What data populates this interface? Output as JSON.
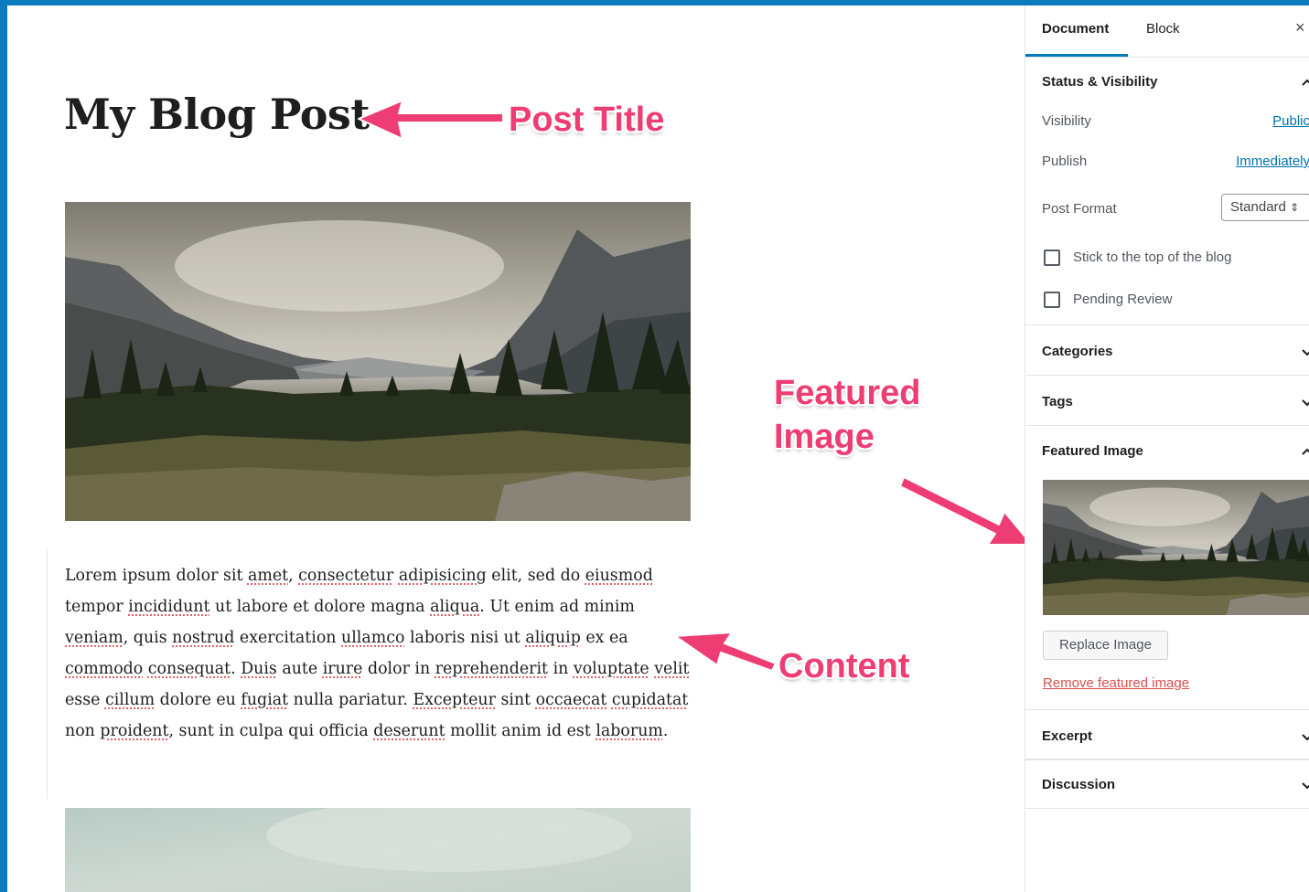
{
  "post": {
    "title": "My Blog Post",
    "content": {
      "part1": "Lorem ipsum dolor sit ",
      "w1": "amet",
      "part2": ", ",
      "w2": "consectetur",
      "part3": " ",
      "w3": "adipisicing",
      "part4": " elit, sed do ",
      "w4": "eiusmod",
      "part5": " tempor ",
      "w5": "incididunt",
      "part6": " ut labore et dolore magna ",
      "w6": "aliqua",
      "part7": ". Ut enim ad minim ",
      "w7": "veniam",
      "part8": ", quis ",
      "w8": "nostrud",
      "part9": " exercitation ",
      "w9": "ullamco",
      "part10": " laboris nisi ut ",
      "w10": "aliquip",
      "part11": " ex ea ",
      "w11": "commodo",
      "part12": " ",
      "w12": "consequat",
      "part13": ". ",
      "w13": "Duis",
      "part14": " aute ",
      "w14": "irure",
      "part15": " dolor in ",
      "w15": "reprehenderit",
      "part16": " in ",
      "w16": "voluptate",
      "part17": " ",
      "w17": "velit",
      "part18": " esse ",
      "w18": "cillum",
      "part19": " dolore eu ",
      "w19": "fugiat",
      "part20": " nulla pariatur. ",
      "w20": "Excepteur",
      "part21": " sint ",
      "w21": "occaecat",
      "part22": " ",
      "w22": "cupidatat",
      "part23": " non ",
      "w23": "proident",
      "part24": ", sunt in culpa qui officia ",
      "w24": "deserunt",
      "part25": " mollit anim id est ",
      "w25": "laborum",
      "part26": "."
    }
  },
  "annotations": {
    "post_title": "Post Title",
    "featured_line1": "Featured",
    "featured_line2": "Image",
    "content": "Content",
    "color": "#ee3d72"
  },
  "sidebar": {
    "tabs": {
      "document": "Document",
      "block": "Block"
    },
    "close_icon": "×",
    "status": {
      "title": "Status & Visibility",
      "visibility_label": "Visibility",
      "visibility_value": "Public",
      "publish_label": "Publish",
      "publish_value": "Immediately",
      "format_label": "Post Format",
      "format_value": "Standard",
      "format_arrows": "⇕",
      "sticky_label": "Stick to the top of the blog",
      "pending_label": "Pending Review"
    },
    "categories": "Categories",
    "tags": "Tags",
    "featured_image": {
      "title": "Featured Image",
      "replace_button": "Replace Image",
      "remove_link": "Remove featured image"
    },
    "excerpt": "Excerpt",
    "discussion": "Discussion"
  },
  "colors": {
    "frame": "#0a7bbf",
    "link": "#0073aa",
    "accent": "#007cba",
    "danger": "#d94f4f"
  }
}
